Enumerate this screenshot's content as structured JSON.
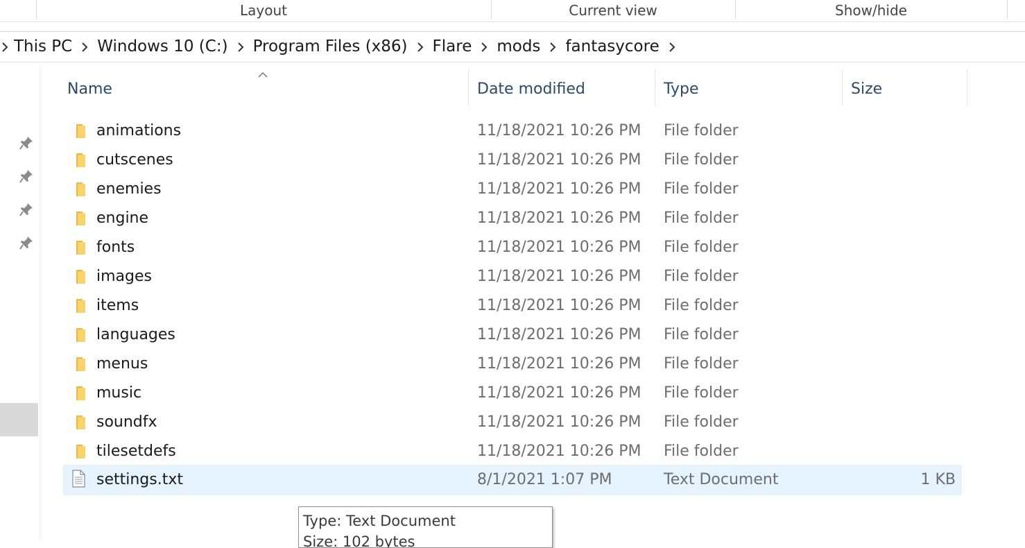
{
  "ribbon": {
    "groups": [
      "Layout",
      "Current view",
      "Show/hide"
    ]
  },
  "address": {
    "crumbs": [
      "This PC",
      "Windows 10 (C:)",
      "Program Files (x86)",
      "Flare",
      "mods",
      "fantasycore"
    ]
  },
  "columns": {
    "name": "Name",
    "date": "Date modified",
    "type": "Type",
    "size": "Size"
  },
  "files": [
    {
      "name": "animations",
      "date": "11/18/2021 10:26 PM",
      "type": "File folder",
      "size": "",
      "icon": "folder-icon"
    },
    {
      "name": "cutscenes",
      "date": "11/18/2021 10:26 PM",
      "type": "File folder",
      "size": "",
      "icon": "folder-icon"
    },
    {
      "name": "enemies",
      "date": "11/18/2021 10:26 PM",
      "type": "File folder",
      "size": "",
      "icon": "folder-icon"
    },
    {
      "name": "engine",
      "date": "11/18/2021 10:26 PM",
      "type": "File folder",
      "size": "",
      "icon": "folder-icon"
    },
    {
      "name": "fonts",
      "date": "11/18/2021 10:26 PM",
      "type": "File folder",
      "size": "",
      "icon": "folder-icon"
    },
    {
      "name": "images",
      "date": "11/18/2021 10:26 PM",
      "type": "File folder",
      "size": "",
      "icon": "folder-icon"
    },
    {
      "name": "items",
      "date": "11/18/2021 10:26 PM",
      "type": "File folder",
      "size": "",
      "icon": "folder-icon"
    },
    {
      "name": "languages",
      "date": "11/18/2021 10:26 PM",
      "type": "File folder",
      "size": "",
      "icon": "folder-icon"
    },
    {
      "name": "menus",
      "date": "11/18/2021 10:26 PM",
      "type": "File folder",
      "size": "",
      "icon": "folder-icon"
    },
    {
      "name": "music",
      "date": "11/18/2021 10:26 PM",
      "type": "File folder",
      "size": "",
      "icon": "folder-icon"
    },
    {
      "name": "soundfx",
      "date": "11/18/2021 10:26 PM",
      "type": "File folder",
      "size": "",
      "icon": "folder-icon"
    },
    {
      "name": "tilesetdefs",
      "date": "11/18/2021 10:26 PM",
      "type": "File folder",
      "size": "",
      "icon": "folder-icon"
    },
    {
      "name": "settings.txt",
      "date": "8/1/2021 1:07 PM",
      "type": "Text Document",
      "size": "1 KB",
      "icon": "text-file-icon",
      "selected": true
    }
  ],
  "tooltip": {
    "line1": "Type: Text Document",
    "line2": "Size: 102 bytes"
  },
  "colors": {
    "selection": "#e5f3ff",
    "folder": "#f6d36b",
    "header_text": "#2b4a6b"
  }
}
